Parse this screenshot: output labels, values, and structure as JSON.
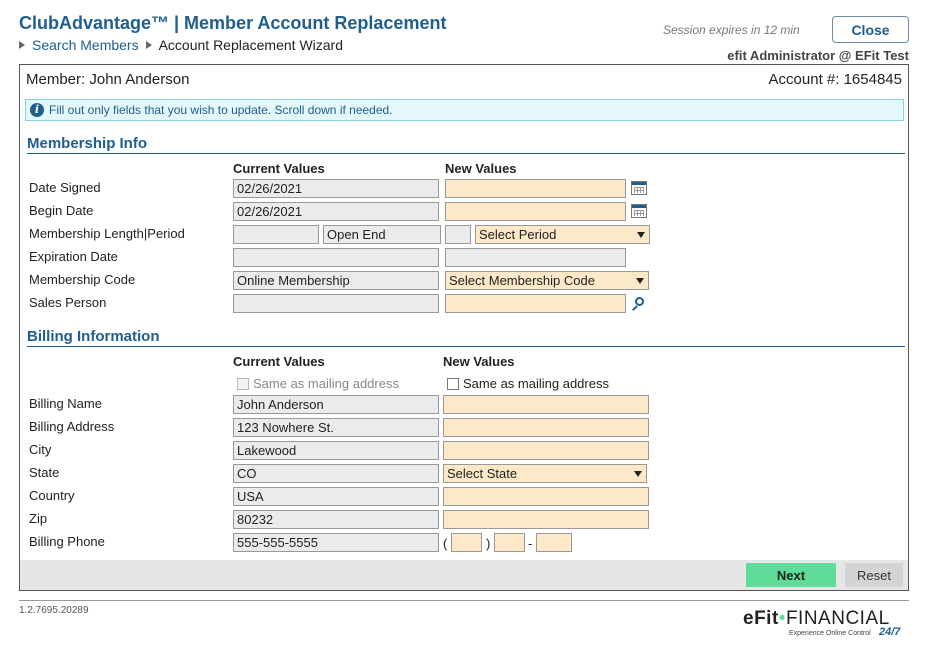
{
  "header": {
    "title": "ClubAdvantage™ | Member Account Replacement",
    "breadcrumb": {
      "link": "Search Members",
      "current": "Account Replacement Wizard"
    },
    "session": "Session expires in 12 min",
    "close_label": "Close",
    "user": "efit Administrator @ EFit Test"
  },
  "member": {
    "name": "Member: John Anderson",
    "account": "Account #: 1654845"
  },
  "info": "Fill out only fields that you wish to update. Scroll down if needed.",
  "membership": {
    "title": "Membership Info",
    "col_current": "Current Values",
    "col_new": "New Values",
    "labels": {
      "date_signed": "Date Signed",
      "begin_date": "Begin Date",
      "length_period": "Membership Length|Period",
      "expiration": "Expiration Date",
      "code": "Membership Code",
      "sales": "Sales Person"
    },
    "current": {
      "date_signed": "02/26/2021",
      "begin_date": "02/26/2021",
      "length": "",
      "period": "Open End",
      "expiration": "",
      "code": "Online Membership",
      "sales": ""
    },
    "new": {
      "period_select": "Select Period",
      "code_select": "Select Membership Code"
    }
  },
  "billing": {
    "title": "Billing Information",
    "col_current": "Current Values",
    "col_new": "New Values",
    "same_as_mailing": "Same as mailing address",
    "labels": {
      "name": "Billing Name",
      "address": "Billing Address",
      "city": "City",
      "state": "State",
      "country": "Country",
      "zip": "Zip",
      "phone": "Billing Phone"
    },
    "current": {
      "name": "John Anderson",
      "address": "123 Nowhere St.",
      "city": "Lakewood",
      "state": "CO",
      "country": "USA",
      "zip": "80232",
      "phone": "555-555-5555"
    },
    "new": {
      "state_select": "Select State"
    },
    "phone_open": "(",
    "phone_close": ")",
    "phone_dash": "-"
  },
  "actions": {
    "next": "Next",
    "reset": "Reset"
  },
  "footer": {
    "version": "1.2.7695.20289",
    "logo_bold": "eFit",
    "logo_sep": "•",
    "logo_rest": "FINANCIAL",
    "logo_tag": "Experience Online Control",
    "logo_247": "24/7"
  }
}
